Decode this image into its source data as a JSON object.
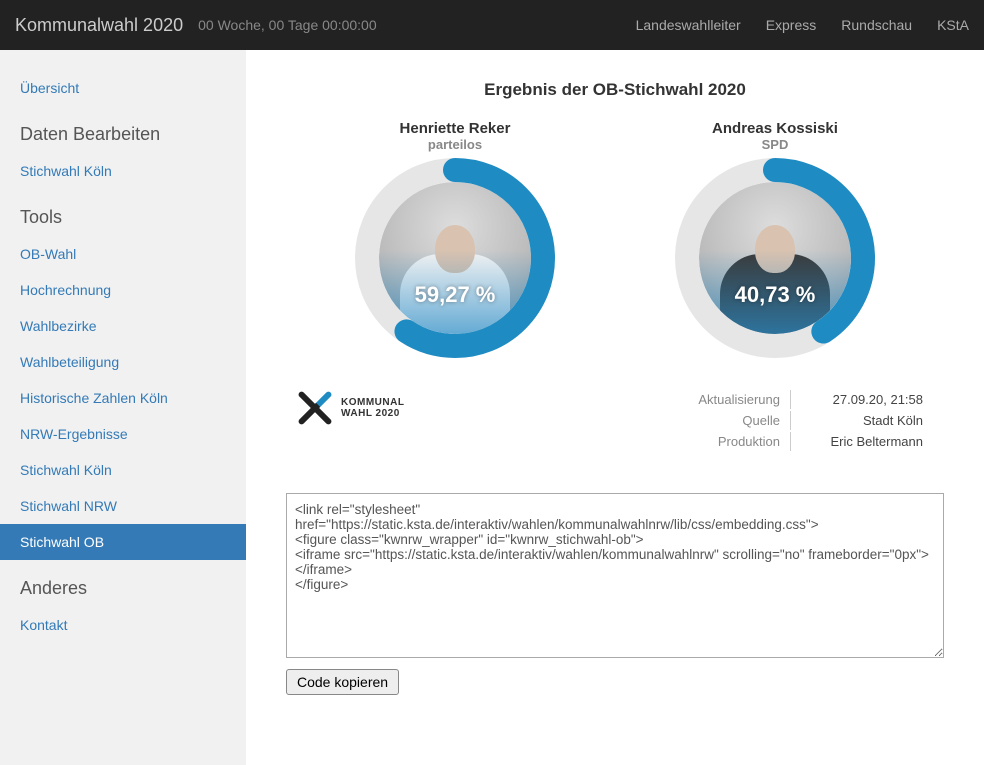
{
  "navbar": {
    "brand": "Kommunalwahl 2020",
    "countdown": "00 Woche, 00 Tage 00:00:00",
    "links": [
      "Landeswahlleiter",
      "Express",
      "Rundschau",
      "KStA"
    ]
  },
  "sidebar": {
    "top": [
      {
        "label": "Übersicht"
      }
    ],
    "sections": [
      {
        "title": "Daten Bearbeiten",
        "items": [
          {
            "label": "Stichwahl Köln"
          }
        ]
      },
      {
        "title": "Tools",
        "items": [
          {
            "label": "OB-Wahl"
          },
          {
            "label": "Hochrechnung"
          },
          {
            "label": "Wahlbezirke"
          },
          {
            "label": "Wahlbeteiligung"
          },
          {
            "label": "Historische Zahlen Köln"
          },
          {
            "label": "NRW-Ergebnisse"
          },
          {
            "label": "Stichwahl Köln"
          },
          {
            "label": "Stichwahl NRW"
          },
          {
            "label": "Stichwahl OB",
            "active": true
          }
        ]
      },
      {
        "title": "Anderes",
        "items": [
          {
            "label": "Kontakt"
          }
        ]
      }
    ]
  },
  "chart_data": {
    "type": "pie",
    "title": "Ergebnis der OB-Stichwahl 2020",
    "series": [
      {
        "name": "Henriette Reker",
        "party": "parteilos",
        "value": 59.27,
        "display": "59,27 %",
        "color": "#1e8bc3"
      },
      {
        "name": "Andreas Kossiski",
        "party": "SPD",
        "value": 40.73,
        "display": "40,73 %",
        "color": "#1e8bc3"
      }
    ],
    "ylim": [
      0,
      100
    ]
  },
  "logo": {
    "line1": "KOMMUNAL",
    "line2": "WAHL 2020"
  },
  "meta": {
    "rows": [
      {
        "k": "Aktualisierung",
        "v": "27.09.20, 21:58"
      },
      {
        "k": "Quelle",
        "v": "Stadt Köln"
      },
      {
        "k": "Produktion",
        "v": "Eric Beltermann"
      }
    ]
  },
  "embed": {
    "code": "<link rel=\"stylesheet\" href=\"https://static.ksta.de/interaktiv/wahlen/kommunalwahlnrw/lib/css/embedding.css\">\n<figure class=\"kwnrw_wrapper\" id=\"kwnrw_stichwahl-ob\">\n<iframe src=\"https://static.ksta.de/interaktiv/wahlen/kommunalwahlnrw\" scrolling=\"no\" frameborder=\"0px\"></iframe>\n</figure>",
    "button": "Code kopieren"
  }
}
